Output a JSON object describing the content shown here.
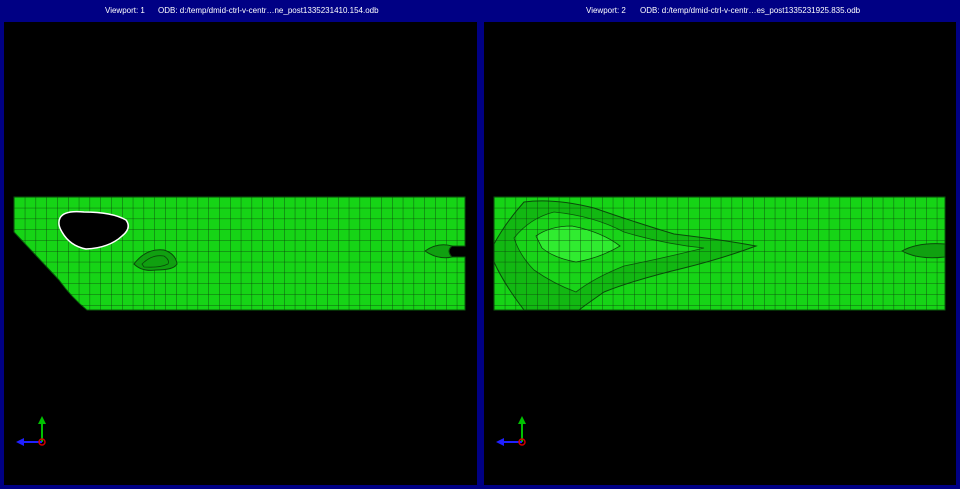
{
  "viewports": [
    {
      "name_label": "Viewport: 1",
      "odb_label": "ODB: d:/temp/dmid-ctrl-v-centr…ne_post1335231410.154.odb",
      "mesh_color": "#16d416",
      "grid_color": "#0a3a0a",
      "void_color": "#ffffff"
    },
    {
      "name_label": "Viewport: 2",
      "odb_label": "ODB: d:/temp/dmid-ctrl-v-centr…es_post1335231925.835.odb",
      "mesh_color": "#16d416",
      "grid_color": "#0a3a0a",
      "void_color": "#ffffff"
    }
  ],
  "colors": {
    "frame_blue": "#000084",
    "canvas_black": "#000000",
    "axis_y_green": "#00c000",
    "axis_x_blue": "#2020ff",
    "axis_z_red": "#d00000"
  },
  "icons": [
    "triad-axes-icon"
  ]
}
